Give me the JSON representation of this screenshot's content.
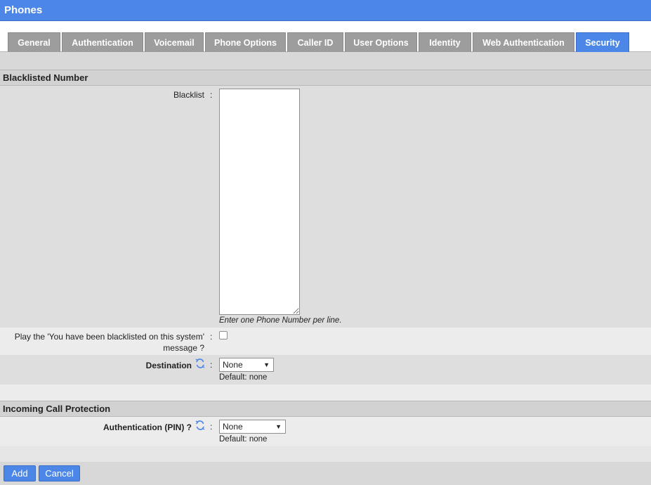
{
  "window": {
    "title": "Phones"
  },
  "tabs": [
    {
      "label": "General",
      "active": false
    },
    {
      "label": "Authentication",
      "active": false
    },
    {
      "label": "Voicemail",
      "active": false
    },
    {
      "label": "Phone Options",
      "active": false
    },
    {
      "label": "Caller ID",
      "active": false
    },
    {
      "label": "User Options",
      "active": false
    },
    {
      "label": "Identity",
      "active": false
    },
    {
      "label": "Web Authentication",
      "active": false
    },
    {
      "label": "Security",
      "active": true
    }
  ],
  "blacklisted": {
    "section_title": "Blacklisted Number",
    "blacklist_label": "Blacklist",
    "blacklist_value": "",
    "blacklist_hint": "Enter one Phone Number per line.",
    "play_message_label_line1": "Play the 'You have been blacklisted on this system'",
    "play_message_label_line2": "message ?",
    "play_message_checked": false,
    "destination_label": "Destination",
    "destination_value": "None",
    "destination_default": "Default: none"
  },
  "incoming": {
    "section_title": "Incoming Call Protection",
    "auth_label": "Authentication (PIN) ?",
    "auth_value": "None",
    "auth_default": "Default: none"
  },
  "colon": ":",
  "icons": {
    "refresh": "refresh-icon",
    "dropdown": "chevron-down-icon"
  },
  "buttons": {
    "add": "Add",
    "cancel": "Cancel"
  },
  "colors": {
    "accent": "#4c87e8",
    "tab_inactive": "#9d9d9d"
  }
}
